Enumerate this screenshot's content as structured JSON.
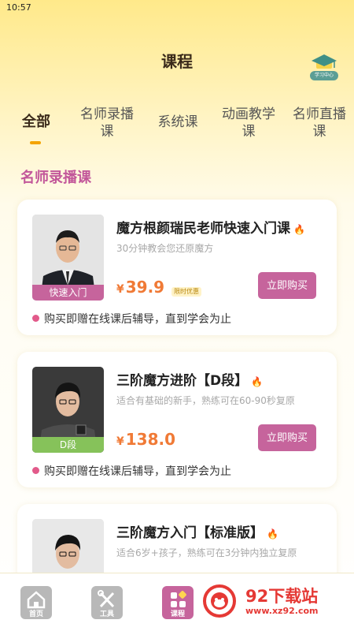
{
  "status_bar": {
    "time": "10:57"
  },
  "header": {
    "title": "课程",
    "study_center_label": "学习中心"
  },
  "tabs": [
    {
      "label": "全部",
      "active": true
    },
    {
      "label": "名师录播课",
      "line1": "名师录播",
      "line2": "课"
    },
    {
      "label": "系统课"
    },
    {
      "label": "动画教学课",
      "line1": "动画教学",
      "line2": "课"
    },
    {
      "label": "名师直播课",
      "line1": "名师直播",
      "line2": "课"
    }
  ],
  "section": {
    "title": "名师录播课"
  },
  "courses": [
    {
      "title": "魔方根颜瑞民老师快速入门课",
      "subtitle": "30分钟教会您还原魔方",
      "tag": "快速入门",
      "tag_color": "#c6649c",
      "price_symbol": "¥",
      "price": "39.9",
      "promo": "限时优惠",
      "buy_label": "立即购买",
      "gift": "购买即赠在线课后辅导，直到学会为止"
    },
    {
      "title": "三阶魔方进阶【D段】",
      "subtitle": "适合有基础的新手，熟练可在60-90秒复原",
      "tag": "D段",
      "tag_color": "#86c25a",
      "price_symbol": "¥",
      "price": "138.0",
      "buy_label": "立即购买",
      "gift": "购买即赠在线课后辅导，直到学会为止"
    },
    {
      "title": "三阶魔方入门【标准版】",
      "subtitle": "适合6岁+孩子，熟练可在3分钟内独立复原"
    }
  ],
  "tabbar": [
    {
      "label": "首页",
      "icon": "home-icon"
    },
    {
      "label": "工具",
      "icon": "tools-icon"
    },
    {
      "label": "课程",
      "icon": "course-icon",
      "active": true
    }
  ],
  "watermark": {
    "title": "92下载站",
    "url": "www.xz92.com"
  },
  "colors": {
    "accent": "#c6649c",
    "price": "#f07a36",
    "tab_indicator": "#f4a300"
  }
}
